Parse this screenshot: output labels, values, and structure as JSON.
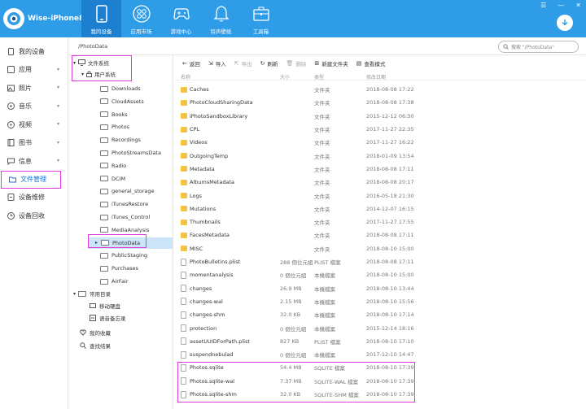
{
  "app": {
    "device_name": "Wise-iPhone8"
  },
  "nav": [
    {
      "label": "我的设备",
      "icon": "phone-icon",
      "active": true
    },
    {
      "label": "应用市场",
      "icon": "apps-grid-icon",
      "active": false
    },
    {
      "label": "游戏中心",
      "icon": "gamepad-icon",
      "active": false
    },
    {
      "label": "铃声壁纸",
      "icon": "bell-icon",
      "active": false
    },
    {
      "label": "工具箱",
      "icon": "toolbox-icon",
      "active": false
    }
  ],
  "sidebar": [
    {
      "label": "我的设备",
      "icon": "device-icon"
    },
    {
      "label": "应用",
      "icon": "app-icon",
      "arrow": "▾"
    },
    {
      "label": "照片",
      "icon": "photo-icon",
      "arrow": "▾"
    },
    {
      "label": "音乐",
      "icon": "music-icon",
      "arrow": "▾"
    },
    {
      "label": "视频",
      "icon": "video-icon",
      "arrow": "▾"
    },
    {
      "label": "图书",
      "icon": "book-icon",
      "arrow": "▾"
    },
    {
      "label": "信息",
      "icon": "message-icon",
      "arrow": "▾"
    },
    {
      "label": "文件管理",
      "icon": "folder-icon",
      "selected": true
    },
    {
      "label": "设备维修",
      "icon": "repair-icon"
    },
    {
      "label": "设备回收",
      "icon": "recycle-icon"
    }
  ],
  "path": "/PhotoData",
  "search": {
    "placeholder": "搜索 \"/PhotoData\""
  },
  "tree": {
    "root": "文件系统",
    "user_system": "用户系统",
    "folders": [
      "Downloads",
      "CloudAssets",
      "Books",
      "Photos",
      "Recordings",
      "PhotoStreamsData",
      "Radio",
      "DCIM",
      "general_storage",
      "iTunesRestore",
      "iTunes_Control",
      "MediaAnalysis",
      "PhotoData",
      "PublicStaging",
      "Purchases",
      "AirFair"
    ],
    "selected": "PhotoData",
    "common": "常用目录",
    "common_items": [
      "移动硬盘",
      "语音备忘录"
    ],
    "favorites": "我的收藏",
    "search_results": "查找结果"
  },
  "toolbar": [
    {
      "label": "返回",
      "icon": "back-arrow-icon",
      "enabled": true
    },
    {
      "label": "导入",
      "icon": "import-icon",
      "enabled": true
    },
    {
      "label": "导出",
      "icon": "export-icon",
      "enabled": false
    },
    {
      "label": "刷新",
      "icon": "refresh-icon",
      "enabled": true
    },
    {
      "label": "删除",
      "icon": "delete-icon",
      "enabled": false
    },
    {
      "label": "新建文件夹",
      "icon": "new-folder-icon",
      "enabled": true
    },
    {
      "label": "查看模式",
      "icon": "view-mode-icon",
      "enabled": true
    }
  ],
  "columns": {
    "name": "名称",
    "size": "大小",
    "type": "类型",
    "date": "修改日期"
  },
  "files": [
    {
      "name": "Caches",
      "size": "",
      "type": "文件夹",
      "date": "2018-08-08 17:22",
      "folder": true
    },
    {
      "name": "PhotoCloudSharingData",
      "size": "",
      "type": "文件夹",
      "date": "2018-08-08 17:38",
      "folder": true
    },
    {
      "name": "iPhotoSandboxLibrary",
      "size": "",
      "type": "文件夹",
      "date": "2015-12-12 06:30",
      "folder": true
    },
    {
      "name": "CPL",
      "size": "",
      "type": "文件夹",
      "date": "2017-11-27 22:35",
      "folder": true
    },
    {
      "name": "Videos",
      "size": "",
      "type": "文件夹",
      "date": "2017-11-27 16:22",
      "folder": true
    },
    {
      "name": "OutgoingTemp",
      "size": "",
      "type": "文件夹",
      "date": "2018-01-09 13:54",
      "folder": true
    },
    {
      "name": "Metadata",
      "size": "",
      "type": "文件夹",
      "date": "2018-08-08 17:11",
      "folder": true
    },
    {
      "name": "AlbumsMetadata",
      "size": "",
      "type": "文件夹",
      "date": "2018-08-08 20:17",
      "folder": true
    },
    {
      "name": "Logs",
      "size": "",
      "type": "文件夹",
      "date": "2016-05-18 21:30",
      "folder": true
    },
    {
      "name": "Mutations",
      "size": "",
      "type": "文件夹",
      "date": "2014-12-07 16:15",
      "folder": true
    },
    {
      "name": "Thumbnails",
      "size": "",
      "type": "文件夹",
      "date": "2017-11-27 17:55",
      "folder": true
    },
    {
      "name": "FacesMetadata",
      "size": "",
      "type": "文件夹",
      "date": "2018-08-08 17:11",
      "folder": true
    },
    {
      "name": "MISC",
      "size": "",
      "type": "文件夹",
      "date": "2018-08-10 15:00",
      "folder": true
    },
    {
      "name": "PhotoBulletins.plist",
      "size": "288 個位元組",
      "type": "PLIST 檔案",
      "date": "2018-08-08 17:11",
      "folder": false
    },
    {
      "name": "momentanalysis",
      "size": "0 個位元組",
      "type": "本機檔案",
      "date": "2018-08-10 15:00",
      "folder": false
    },
    {
      "name": "changes",
      "size": "26.9 MB",
      "type": "本機檔案",
      "date": "2018-08-10 13:44",
      "folder": false
    },
    {
      "name": "changes-wal",
      "size": "2.15 MB",
      "type": "本機檔案",
      "date": "2018-08-10 15:56",
      "folder": false
    },
    {
      "name": "changes-shm",
      "size": "32.0 KB",
      "type": "本機檔案",
      "date": "2018-08-10 17:14",
      "folder": false
    },
    {
      "name": "protection",
      "size": "0 個位元組",
      "type": "本機檔案",
      "date": "2015-12-14 18:16",
      "folder": false
    },
    {
      "name": "assetUUIDForPath.plist",
      "size": "827 KB",
      "type": "PLIST 檔案",
      "date": "2018-08-10 17:10",
      "folder": false
    },
    {
      "name": "suspendnebulad",
      "size": "0 個位元組",
      "type": "本機檔案",
      "date": "2017-12-10 14:47",
      "folder": false
    },
    {
      "name": "Photos.sqlite",
      "size": "54.4 MB",
      "type": "SQLITE 檔案",
      "date": "2018-08-10 17:39",
      "folder": false
    },
    {
      "name": "Photos.sqlite-wal",
      "size": "7.37 MB",
      "type": "SQLITE-WAL 檔案",
      "date": "2018-08-10 17:39",
      "folder": false
    },
    {
      "name": "Photos.sqlite-shm",
      "size": "32.0 KB",
      "type": "SQLITE-SHM 檔案",
      "date": "2018-08-10 17:39",
      "folder": false
    }
  ],
  "colors": {
    "topbar": "#2f9ce8",
    "nav_active": "#1c7fcf",
    "highlight_box": "#e03ae0",
    "selected_row": "#cce4f7",
    "folder_icon": "#f5c342"
  }
}
